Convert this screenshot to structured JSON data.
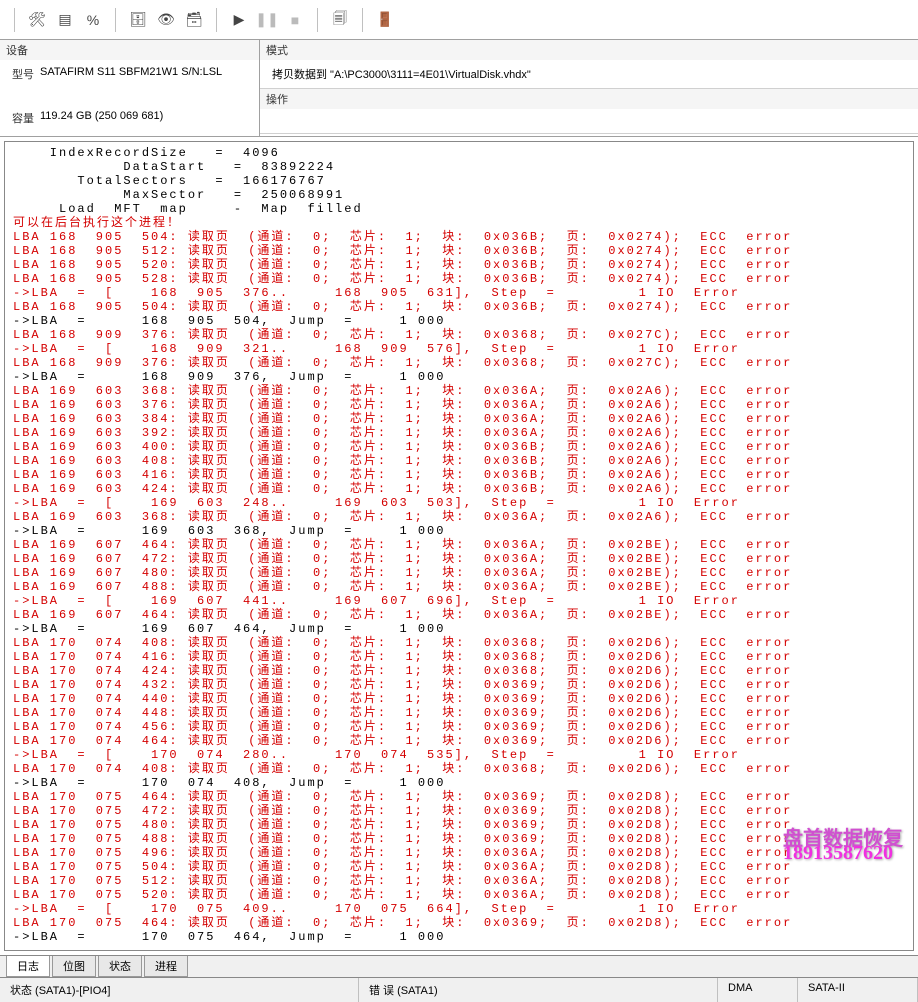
{
  "toolbar_icons": [
    "tools",
    "terminal",
    "percent",
    "disk-tool",
    "binoculars",
    "database",
    "play",
    "pause",
    "stop",
    "copy",
    "exit"
  ],
  "device": {
    "header": "设备",
    "model_label": "型号",
    "model_value": "SATAFIRM   S11 SBFM21W1 S/N:LSL",
    "capacity_label": "容量",
    "capacity_value": "119.24 GB (250 069 681)"
  },
  "mode": {
    "header": "模式",
    "value": "拷贝数据到 \"A:\\PC3000\\3111=4E01\\VirtualDisk.vhdx\""
  },
  "operation": {
    "header": "操作"
  },
  "log_header": [
    "    IndexRecordSize   =  4096",
    "            DataStart   =  83892224",
    "       TotalSectors   =  166176767",
    "            MaxSector   =  250068991",
    "     Load  MFT  map     -  Map  filled"
  ],
  "log_notice": "可以在后台执行这个进程！",
  "log_entries": [
    {
      "t": "err",
      "lba": "168  905  504",
      "blk": "0x036B",
      "page": "0x0274"
    },
    {
      "t": "err",
      "lba": "168  905  512",
      "blk": "0x036B",
      "page": "0x0274"
    },
    {
      "t": "err",
      "lba": "168  905  520",
      "blk": "0x036B",
      "page": "0x0274"
    },
    {
      "t": "err",
      "lba": "168  905  528",
      "blk": "0x036B",
      "page": "0x0274"
    },
    {
      "t": "step",
      "range": "168  905  376..     168  905  631"
    },
    {
      "t": "err",
      "lba": "168  905  504",
      "blk": "0x036B",
      "page": "0x0274"
    },
    {
      "t": "jump",
      "lba": "168  905  504"
    },
    {
      "t": "err",
      "lba": "168  909  376",
      "blk": "0x0368",
      "page": "0x027C"
    },
    {
      "t": "step",
      "range": "168  909  321..     168  909  576"
    },
    {
      "t": "err",
      "lba": "168  909  376",
      "blk": "0x0368",
      "page": "0x027C"
    },
    {
      "t": "jump",
      "lba": "168  909  376"
    },
    {
      "t": "err",
      "lba": "169  603  368",
      "blk": "0x036A",
      "page": "0x02A6"
    },
    {
      "t": "err",
      "lba": "169  603  376",
      "blk": "0x036A",
      "page": "0x02A6"
    },
    {
      "t": "err",
      "lba": "169  603  384",
      "blk": "0x036A",
      "page": "0x02A6"
    },
    {
      "t": "err",
      "lba": "169  603  392",
      "blk": "0x036A",
      "page": "0x02A6"
    },
    {
      "t": "err",
      "lba": "169  603  400",
      "blk": "0x036B",
      "page": "0x02A6"
    },
    {
      "t": "err",
      "lba": "169  603  408",
      "blk": "0x036B",
      "page": "0x02A6"
    },
    {
      "t": "err",
      "lba": "169  603  416",
      "blk": "0x036B",
      "page": "0x02A6"
    },
    {
      "t": "err",
      "lba": "169  603  424",
      "blk": "0x036B",
      "page": "0x02A6"
    },
    {
      "t": "step",
      "range": "169  603  248..     169  603  503"
    },
    {
      "t": "err",
      "lba": "169  603  368",
      "blk": "0x036A",
      "page": "0x02A6"
    },
    {
      "t": "jump",
      "lba": "169  603  368"
    },
    {
      "t": "err",
      "lba": "169  607  464",
      "blk": "0x036A",
      "page": "0x02BE"
    },
    {
      "t": "err",
      "lba": "169  607  472",
      "blk": "0x036A",
      "page": "0x02BE"
    },
    {
      "t": "err",
      "lba": "169  607  480",
      "blk": "0x036A",
      "page": "0x02BE"
    },
    {
      "t": "err",
      "lba": "169  607  488",
      "blk": "0x036A",
      "page": "0x02BE"
    },
    {
      "t": "step",
      "range": "169  607  441..     169  607  696"
    },
    {
      "t": "err",
      "lba": "169  607  464",
      "blk": "0x036A",
      "page": "0x02BE"
    },
    {
      "t": "jump",
      "lba": "169  607  464"
    },
    {
      "t": "err",
      "lba": "170  074  408",
      "blk": "0x0368",
      "page": "0x02D6"
    },
    {
      "t": "err",
      "lba": "170  074  416",
      "blk": "0x0368",
      "page": "0x02D6"
    },
    {
      "t": "err",
      "lba": "170  074  424",
      "blk": "0x0368",
      "page": "0x02D6"
    },
    {
      "t": "err",
      "lba": "170  074  432",
      "blk": "0x0369",
      "page": "0x02D6"
    },
    {
      "t": "err",
      "lba": "170  074  440",
      "blk": "0x0369",
      "page": "0x02D6"
    },
    {
      "t": "err",
      "lba": "170  074  448",
      "blk": "0x0369",
      "page": "0x02D6"
    },
    {
      "t": "err",
      "lba": "170  074  456",
      "blk": "0x0369",
      "page": "0x02D6"
    },
    {
      "t": "err",
      "lba": "170  074  464",
      "blk": "0x0369",
      "page": "0x02D6"
    },
    {
      "t": "step",
      "range": "170  074  280..     170  074  535"
    },
    {
      "t": "err",
      "lba": "170  074  408",
      "blk": "0x0368",
      "page": "0x02D6"
    },
    {
      "t": "jump",
      "lba": "170  074  408"
    },
    {
      "t": "err",
      "lba": "170  075  464",
      "blk": "0x0369",
      "page": "0x02D8"
    },
    {
      "t": "err",
      "lba": "170  075  472",
      "blk": "0x0369",
      "page": "0x02D8"
    },
    {
      "t": "err",
      "lba": "170  075  480",
      "blk": "0x0369",
      "page": "0x02D8"
    },
    {
      "t": "err",
      "lba": "170  075  488",
      "blk": "0x0369",
      "page": "0x02D8"
    },
    {
      "t": "err",
      "lba": "170  075  496",
      "blk": "0x036A",
      "page": "0x02D8"
    },
    {
      "t": "err",
      "lba": "170  075  504",
      "blk": "0x036A",
      "page": "0x02D8"
    },
    {
      "t": "err",
      "lba": "170  075  512",
      "blk": "0x036A",
      "page": "0x02D8"
    },
    {
      "t": "err",
      "lba": "170  075  520",
      "blk": "0x036A",
      "page": "0x02D8"
    },
    {
      "t": "step",
      "range": "170  075  409..     170  075  664"
    },
    {
      "t": "err",
      "lba": "170  075  464",
      "blk": "0x0369",
      "page": "0x02D8"
    },
    {
      "t": "jump",
      "lba": "170  075  464"
    }
  ],
  "watermark": {
    "line1": "盘首数据恢复",
    "line2": "18913587620"
  },
  "tabs": {
    "items": [
      "日志",
      "位图",
      "状态",
      "进程"
    ],
    "active": 0
  },
  "status": {
    "state_label": "状态 (SATA1)-[PIO4]",
    "error_label": "错 误 (SATA1)",
    "dma_label": "DMA",
    "sata2_label": "SATA-II"
  }
}
